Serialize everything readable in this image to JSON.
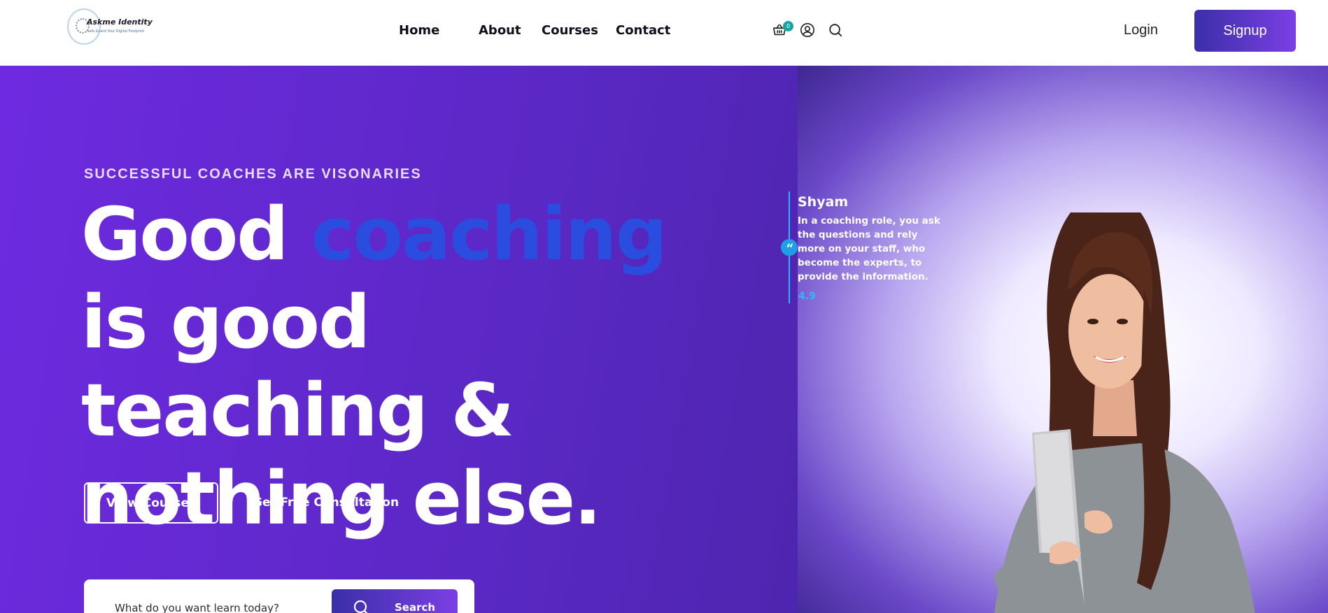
{
  "header": {
    "logo_title": "Askme Identity",
    "logo_tagline": "Safe Guard Your Digital Footprint",
    "nav": [
      "Home",
      "About",
      "Courses",
      "Contact"
    ],
    "cart_count": "0",
    "login_label": "Login",
    "signup_label": "Signup"
  },
  "hero": {
    "kicker": "SUCCESSFUL COACHES ARE VISONARIES",
    "headline_pre": "Good ",
    "headline_accent": "coaching",
    "headline_post": " is good teaching & nothing else.",
    "view_courses_label": "View Courses",
    "consult_label": "Get Free Consultation",
    "search_placeholder": "What do you want learn today?",
    "search_button_label": "Search"
  },
  "testimonial": {
    "quote_mark": "“",
    "name": "Shyam",
    "text": "In a coaching role, you ask the questions and rely more on your staff, who become the experts, to provide the information.",
    "rating": "4.9"
  },
  "colors": {
    "hero_start": "#6e2ae0",
    "hero_end": "#3a2080",
    "accent_word": "#2a4de0",
    "signup_gradient_start": "#3a2fa8",
    "signup_gradient_end": "#7b3fe4",
    "quote_accent": "#2fb2ff"
  },
  "icons": [
    "cart-icon",
    "user-icon",
    "search-icon"
  ]
}
